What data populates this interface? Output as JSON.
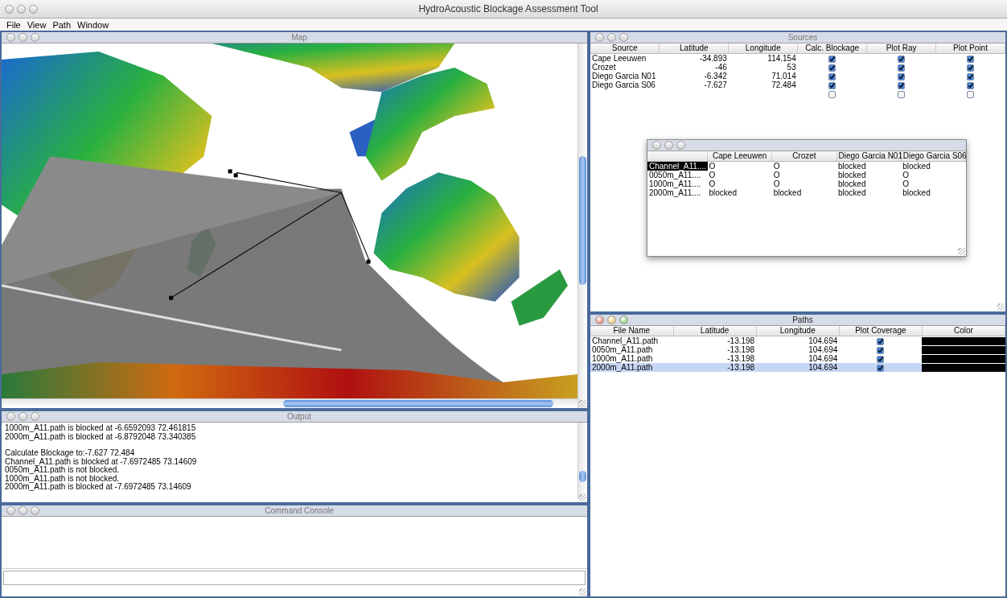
{
  "app_title": "HydroAcoustic Blockage Assessment Tool",
  "menu": [
    "File",
    "View",
    "Path",
    "Window"
  ],
  "map": {
    "title": "Map",
    "active": false
  },
  "output": {
    "title": "Output",
    "active": false,
    "paragraphs": [
      [
        "1000m_A11.path is blocked at  -6.6592093 72.461815",
        "2000m_A11.path is blocked at  -6.8792048 73.340385"
      ],
      [
        "Calculate Blockage to:-7.627 72.484",
        "Channel_A11.path is blocked at  -7.6972485 73.14609",
        "0050m_A11.path is not blocked.",
        "1000m_A11.path is not blocked.",
        "2000m_A11.path is blocked at  -7.6972485 73.14609"
      ]
    ]
  },
  "console": {
    "title": "Command Console",
    "active": false
  },
  "sources": {
    "title": "Sources",
    "active": false,
    "columns": [
      "Source",
      "Latitude",
      "Longitude",
      "Calc. Blockage",
      "Plot Ray",
      "Plot Point"
    ],
    "rows": [
      {
        "name": "Cape Leeuwen",
        "latitude": "-34.893",
        "longitude": "114.154",
        "calc_blockage": true,
        "plot_ray": true,
        "plot_point": true
      },
      {
        "name": "Crozet",
        "latitude": "-46",
        "longitude": "53",
        "calc_blockage": true,
        "plot_ray": true,
        "plot_point": true
      },
      {
        "name": "Diego Garcia N01",
        "latitude": "-6.342",
        "longitude": "71.014",
        "calc_blockage": true,
        "plot_ray": true,
        "plot_point": true
      },
      {
        "name": "Diego Garcia S06",
        "latitude": "-7.627",
        "longitude": "72.484",
        "calc_blockage": true,
        "plot_ray": true,
        "plot_point": true
      },
      {
        "calc_blockage": false,
        "plot_ray": false,
        "plot_point": false
      }
    ]
  },
  "blockage_matrix": {
    "active": false,
    "columns": [
      "Cape Leeuwen",
      "Crozet",
      "Diego Garcia N01",
      "Diego Garcia S06"
    ],
    "rows": [
      {
        "path": "Channel_A11....",
        "selected": true,
        "cells": [
          "O",
          "O",
          "blocked",
          "blocked"
        ]
      },
      {
        "path": "0050m_A11....",
        "selected": false,
        "cells": [
          "O",
          "O",
          "blocked",
          "O"
        ]
      },
      {
        "path": "1000m_A11....",
        "selected": false,
        "cells": [
          "O",
          "O",
          "blocked",
          "O"
        ]
      },
      {
        "path": "2000m_A11....",
        "selected": false,
        "cells": [
          "blocked",
          "blocked",
          "blocked",
          "blocked"
        ]
      }
    ]
  },
  "paths": {
    "title": "Paths",
    "active": true,
    "columns": [
      "File Name",
      "Latitude",
      "Longitude",
      "Plot Coverage",
      "Color"
    ],
    "rows": [
      {
        "file": "Channel_A11.path",
        "latitude": "-13.198",
        "longitude": "104.694",
        "plot_coverage": true,
        "color": "#000000",
        "selected": false
      },
      {
        "file": "0050m_A11.path",
        "latitude": "-13.198",
        "longitude": "104.694",
        "plot_coverage": true,
        "color": "#000000",
        "selected": false
      },
      {
        "file": "1000m_A11.path",
        "latitude": "-13.198",
        "longitude": "104.694",
        "plot_coverage": true,
        "color": "#000000",
        "selected": false
      },
      {
        "file": "2000m_A11.path",
        "latitude": "-13.198",
        "longitude": "104.694",
        "plot_coverage": true,
        "color": "#000000",
        "selected": true
      }
    ]
  }
}
